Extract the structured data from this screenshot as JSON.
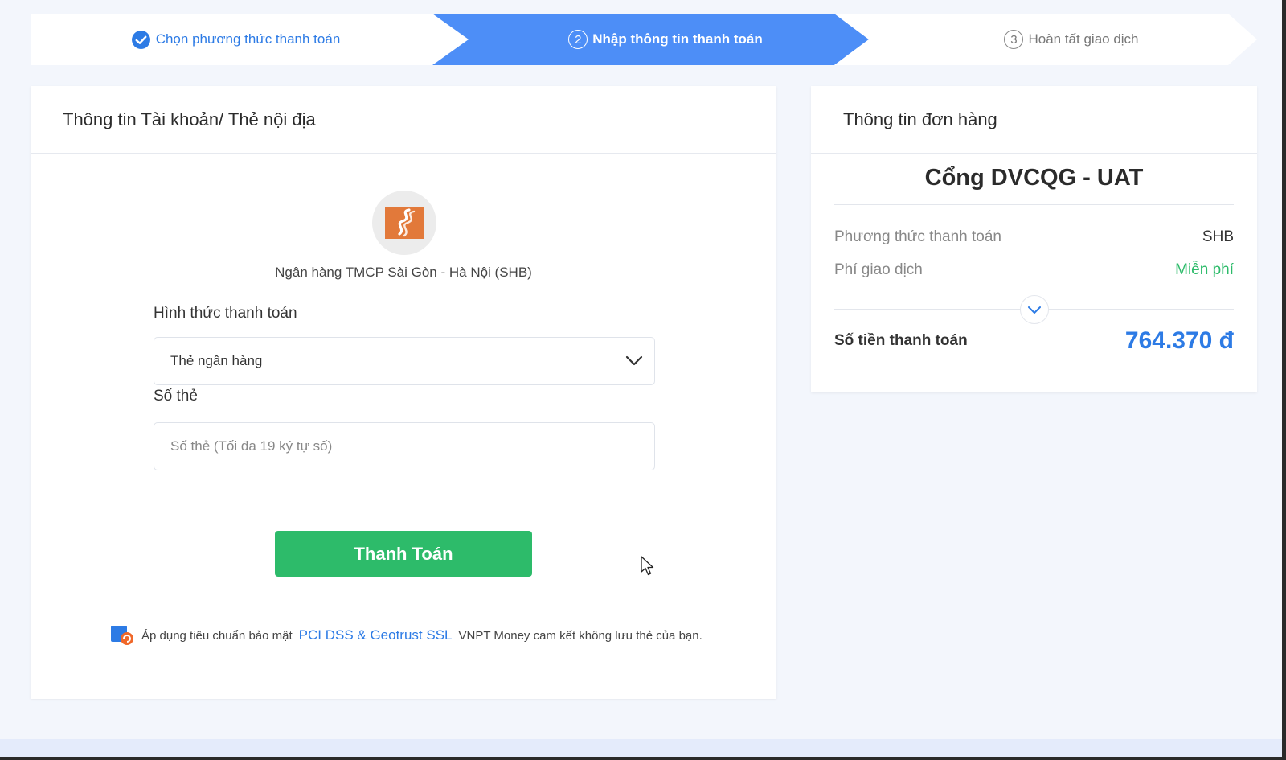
{
  "stepper": {
    "steps": [
      {
        "label": "Chọn phương thức thanh toán",
        "state": "done"
      },
      {
        "number": "2",
        "label": "Nhập thông tin thanh toán",
        "state": "active"
      },
      {
        "number": "3",
        "label": "Hoàn tất giao dịch",
        "state": "pending"
      }
    ]
  },
  "payment_form": {
    "header": "Thông tin Tài khoản/ Thẻ nội địa",
    "bank_name": "Ngân hàng TMCP Sài Gòn - Hà Nội (SHB)",
    "method_label": "Hình thức thanh toán",
    "method_value": "Thẻ ngân hàng",
    "card_label": "Số thẻ",
    "card_placeholder": "Số thẻ (Tối đa 19 ký tự số)",
    "card_value": "",
    "pay_button": "Thanh Toán",
    "security_prefix": "Áp dụng tiêu chuẩn bảo mật",
    "security_highlight": "PCI DSS & Geotrust SSL",
    "security_suffix": "VNPT Money cam kết không lưu thẻ của bạn."
  },
  "order": {
    "header": "Thông tin đơn hàng",
    "merchant": "Cổng DVCQG - UAT",
    "method_key": "Phương thức thanh toán",
    "method_value": "SHB",
    "fee_key": "Phí giao dịch",
    "fee_value": "Miễn phí",
    "total_key": "Số tiền thanh toán",
    "total_value": "764.370 đ"
  },
  "colors": {
    "accent": "#2d7be5",
    "active_step": "#4d8ef7",
    "pay_button": "#2dbb6a",
    "bank_logo": "#e2793a"
  },
  "icons": {
    "step1": "check-circle-icon",
    "select": "chevron-down-icon",
    "expand": "chevron-down-icon",
    "security": "shield-badge-icon",
    "cursor": "mouse-pointer-icon"
  }
}
